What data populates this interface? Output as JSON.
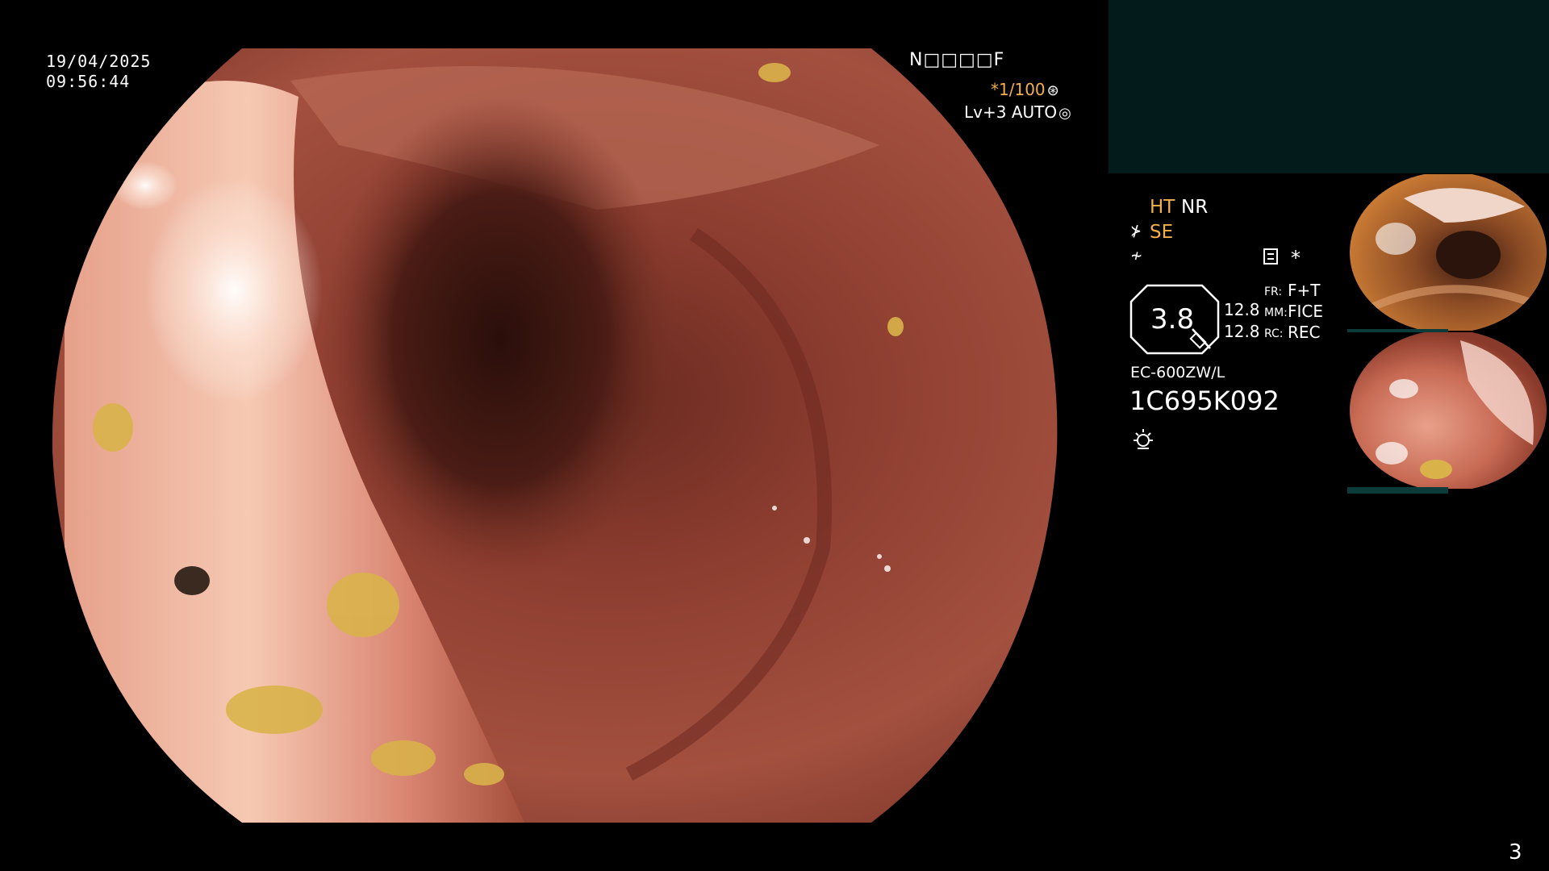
{
  "overlay": {
    "date": "19/04/2025",
    "time": "09:56:44",
    "patient_id": "N□□□□F",
    "shutter": "*1/100",
    "level": "Lv+3 AUTO"
  },
  "status": {
    "ht": "HT",
    "nr": "NR",
    "se": "SE",
    "zoom": "3.8",
    "mm_top": "12.8",
    "mm_bottom": "12.8",
    "fr_label": "FR:",
    "fr_value": "F+T",
    "mm_label": "MM:",
    "mm_value": "FICE",
    "rc_label": "RC:",
    "rc_value": "REC",
    "scope_model": "EC-600ZW/L",
    "scope_serial": "1C695K092"
  },
  "colors": {
    "accent_orange": "#f2b04a",
    "panel_teal": "#031b1b",
    "mucosa": "#a8503c"
  },
  "icons": [
    "shutter-icon",
    "auto-icon",
    "scope-tip-icon",
    "f-icon",
    "menu-icon",
    "star-icon",
    "light-icon"
  ],
  "page": {
    "number": "3"
  }
}
